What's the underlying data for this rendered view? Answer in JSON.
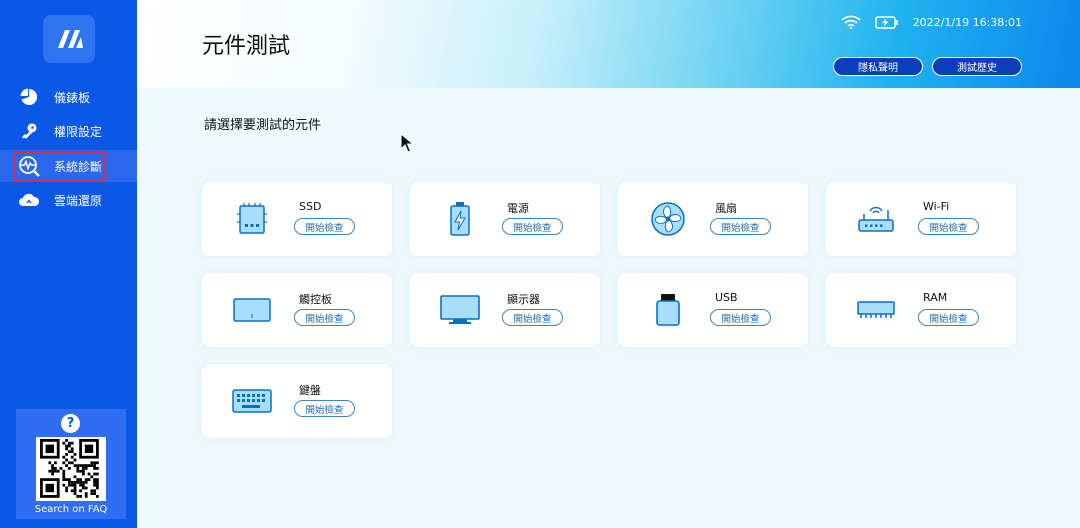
{
  "sidebar": {
    "items": [
      {
        "label": "儀錶板",
        "icon": "pie-chart-icon"
      },
      {
        "label": "權限設定",
        "icon": "key-icon"
      },
      {
        "label": "系統診斷",
        "icon": "diagnostics-icon"
      },
      {
        "label": "雲端還原",
        "icon": "cloud-icon"
      }
    ],
    "active_index": 2,
    "faq": {
      "help": "?",
      "label": "Search on FAQ"
    }
  },
  "header": {
    "title": "元件測試",
    "datetime": "2022/1/19 16:38:01",
    "buttons": {
      "privacy": "隱私聲明",
      "history": "測試歷史"
    }
  },
  "main": {
    "subtitle": "請選擇要測試的元件",
    "components": [
      {
        "name": "SSD",
        "action": "開始檢查",
        "icon": "ssd-icon"
      },
      {
        "name": "電源",
        "action": "開始檢查",
        "icon": "battery-icon"
      },
      {
        "name": "風扇",
        "action": "開始檢查",
        "icon": "fan-icon"
      },
      {
        "name": "Wi-Fi",
        "action": "開始檢查",
        "icon": "router-icon"
      },
      {
        "name": "觸控板",
        "action": "開始檢查",
        "icon": "touchpad-icon"
      },
      {
        "name": "顯示器",
        "action": "開始檢查",
        "icon": "monitor-icon"
      },
      {
        "name": "USB",
        "action": "開始檢查",
        "icon": "usb-icon"
      },
      {
        "name": "RAM",
        "action": "開始檢查",
        "icon": "ram-icon"
      },
      {
        "name": "鍵盤",
        "action": "開始檢查",
        "icon": "keyboard-icon"
      }
    ]
  },
  "colors": {
    "sidebar": "#0b57e8",
    "accent": "#1b67b3",
    "icon_fill": "#9fdaf8",
    "icon_stroke": "#0c6fc7"
  }
}
